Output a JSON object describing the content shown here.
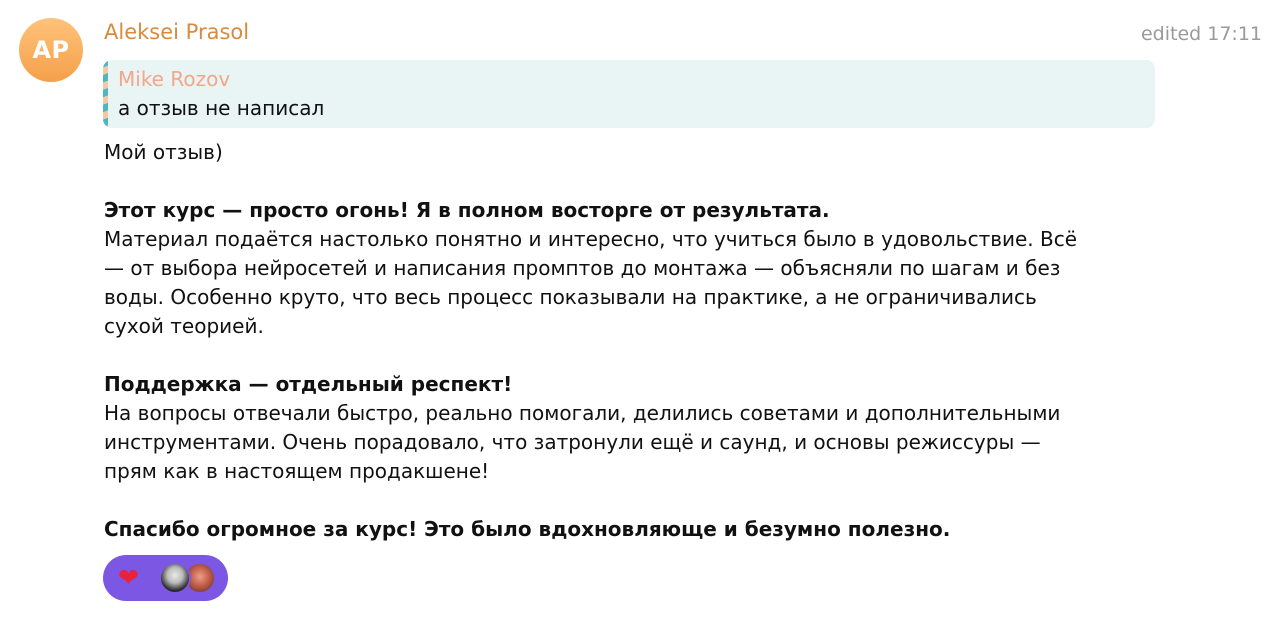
{
  "message": {
    "avatar_initials": "AP",
    "sender_name": "Aleksei Prasol",
    "timestamp": "edited 17:11",
    "reply": {
      "author": "Mike Rozov",
      "text": "а отзыв не написал"
    },
    "body": {
      "intro": "Мой отзыв)",
      "heading1": "Этот курс — просто огонь! Я в полном восторге от результата.",
      "para1_line1": "Материал подаётся настолько понятно и интересно, что учиться было в удовольствие. Всё",
      "para1_line2": "— от выбора нейросетей и написания промптов до монтажа — объясняли по шагам и без",
      "para1_line3": "воды. Особенно круто, что весь процесс показывали на практике, а не ограничивались",
      "para1_line4": "сухой теорией.",
      "heading2": "Поддержка — отдельный респект!",
      "para2_line1": "На вопросы отвечали быстро, реально помогали, делились советами и дополнительными",
      "para2_line2": "инструментами. Очень порадовало, что затронули ещё и саунд, и основы режиссуры —",
      "para2_line3": "прям как в настоящем продакшене!",
      "closing": "Спасибо огромное за курс! Это было вдохновляюще и безумно полезно."
    },
    "reactions": {
      "emoji": "❤",
      "icon": "heart-icon",
      "reactor_count": 2,
      "accent_color": "#7b57e4"
    }
  },
  "colors": {
    "sender": "#d98a3c",
    "reply_author": "#f2a788",
    "reply_background": "#e9f4f5",
    "timestamp": "#9a9a9a",
    "avatar": "#f5a04a"
  }
}
